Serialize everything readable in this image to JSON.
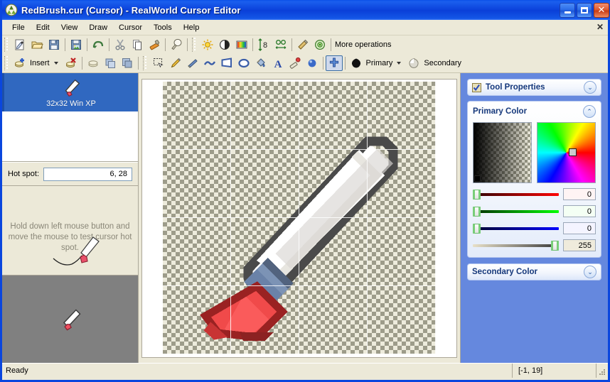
{
  "window": {
    "title": "RedBrush.cur (Cursor) - RealWorld Cursor Editor",
    "app_icon": "app-icon",
    "controls": {
      "minimize": "_",
      "maximize": "□",
      "close": "✕"
    }
  },
  "menu": {
    "items": [
      {
        "label": "File"
      },
      {
        "label": "Edit"
      },
      {
        "label": "View"
      },
      {
        "label": "Draw"
      },
      {
        "label": "Cursor"
      },
      {
        "label": "Tools"
      },
      {
        "label": "Help"
      }
    ],
    "close_document": "✕"
  },
  "toolbar_main": {
    "buttons": [
      {
        "name": "new-icon"
      },
      {
        "name": "open-icon"
      },
      {
        "name": "save-icon"
      },
      {
        "name": "save-as-image-icon"
      },
      {
        "name": "undo-icon"
      },
      {
        "name": "cut-icon"
      },
      {
        "name": "copy-icon"
      },
      {
        "name": "paste-icon"
      },
      {
        "name": "fill-bulb-icon"
      },
      {
        "name": "brightness-icon"
      },
      {
        "name": "contrast-icon"
      },
      {
        "name": "colorize-icon"
      },
      {
        "name": "flip-vertical-icon"
      },
      {
        "name": "flip-horizontal-icon"
      },
      {
        "name": "smooth-icon"
      },
      {
        "name": "effects-icon"
      }
    ],
    "more_operations_label": "More operations"
  },
  "toolbar_layers": {
    "insert_label": "Insert",
    "buttons": [
      {
        "name": "insert-image-icon"
      },
      {
        "name": "delete-image-icon"
      },
      {
        "name": "image-properties-icon"
      },
      {
        "name": "duplicate-icon"
      },
      {
        "name": "merge-icon"
      }
    ]
  },
  "toolbar_tools": {
    "buttons": [
      {
        "name": "select-rectangle-icon"
      },
      {
        "name": "pencil-icon"
      },
      {
        "name": "line-icon"
      },
      {
        "name": "curve-icon"
      },
      {
        "name": "rectangle-icon"
      },
      {
        "name": "ellipse-icon"
      },
      {
        "name": "flood-fill-icon"
      },
      {
        "name": "text-icon"
      },
      {
        "name": "eraser-icon"
      },
      {
        "name": "sphere-icon"
      },
      {
        "name": "hotspot-icon"
      }
    ],
    "primary_label": "Primary",
    "secondary_label": "Secondary"
  },
  "left_panel": {
    "layer": {
      "label": "32x32 Win XP",
      "icon": "brush-cursor-icon",
      "selected": true
    },
    "hotspot": {
      "caption": "Hot spot:",
      "value": "6, 28"
    },
    "hint": "Hold down left mouse button and move the mouse to test cursor hot spot.",
    "preview_icon": "brush-cursor-preview"
  },
  "canvas": {
    "image_name": "brush-cursor-32x32",
    "zoom_grid_cells": 4,
    "checker_colors": [
      "#EDEBDC",
      "#9D9C8A"
    ]
  },
  "right_panel": {
    "tool_properties": {
      "title": "Tool Properties",
      "checkbox_icon": "checkbox-checked-icon",
      "chevron": "expand-down-icon"
    },
    "primary_color": {
      "title": "Primary Color",
      "chevron": "collapse-up-icon",
      "sliders": [
        {
          "name": "red",
          "value": "0",
          "track_color": "#CC0000",
          "fill_color": "#FFE8E8",
          "pos": 0
        },
        {
          "name": "green",
          "value": "0",
          "track_color": "#00CC00",
          "fill_color": "#E8FFE8",
          "pos": 0
        },
        {
          "name": "blue",
          "value": "0",
          "track_color": "#0000CC",
          "fill_color": "#E8E8FF",
          "pos": 0
        },
        {
          "name": "alpha",
          "value": "255",
          "track_color": "#888060",
          "fill_color": "#EFEBDC",
          "pos": 100
        }
      ]
    },
    "secondary_color": {
      "title": "Secondary Color",
      "chevron": "expand-down-icon"
    }
  },
  "statusbar": {
    "message": "Ready",
    "coordinates": "[-1, 19]"
  },
  "colors": {
    "titlebar_blue": "#0A46DE",
    "panel_blue": "#6588DE",
    "selection_blue": "#3068C0",
    "chrome_beige": "#ECE9D8",
    "preview_gray": "#808080"
  }
}
